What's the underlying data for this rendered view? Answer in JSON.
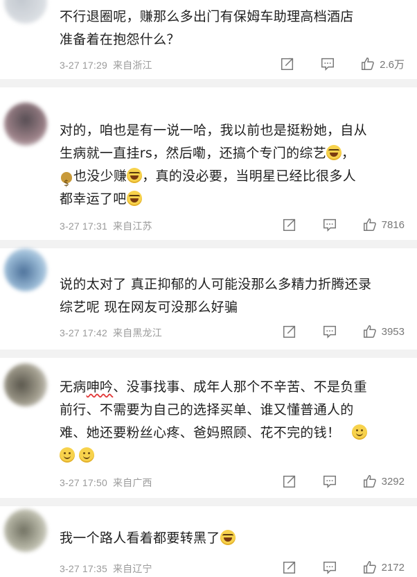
{
  "comments": [
    {
      "lines": [
        "不行退圈呢，赚那么多出门有保姆车助理高档酒店",
        "准备着在抱怨什么？"
      ],
      "date": "3-27 17:29",
      "location": "来自浙江",
      "likes": "2.6万"
    },
    {
      "lines": [
        "对的，咱也是有一说一哈，我以前也是挺粉她，自从",
        "生病就一直挂rs，然后嘞，还搞个专门的综艺",
        "也没少赚",
        "，真的没必要，当明星已经比很多人",
        "都幸运了吧"
      ],
      "date": "3-27 17:31",
      "location": "来自江苏",
      "likes": "7816"
    },
    {
      "lines": [
        "说的太对了 真正抑郁的人可能没那么多精力折腾还录",
        "综艺呢 现在网友可没那么好骗"
      ],
      "date": "3-27 17:42",
      "location": "来自黑龙江",
      "likes": "3953"
    },
    {
      "lines": [
        "无病",
        "呻吟",
        "、没事找事、成年人那个不辛苦、不是负重",
        "前行、不需要为自己的选择买单、谁又懂普通人的",
        "难、她还要粉丝心疼、爸妈照顾、花不完的钱！"
      ],
      "date": "3-27 17:50",
      "location": "来自广西",
      "likes": "3292"
    },
    {
      "lines": [
        "我一个路人看着都要转黑了"
      ],
      "date": "3-27 17:35",
      "location": "来自辽宁",
      "likes": "2172"
    }
  ],
  "icons": {
    "share": "share-icon",
    "comment": "comment-icon",
    "like": "like-icon",
    "emoji_laugh": "laugh-cry-emoji",
    "emoji_smile": "smile-emoji",
    "moneybag": "moneybag-emoji"
  },
  "colors": {
    "meta": "#9a9a9a",
    "divider": "#f2f2f2",
    "text": "#1f1f1f"
  }
}
